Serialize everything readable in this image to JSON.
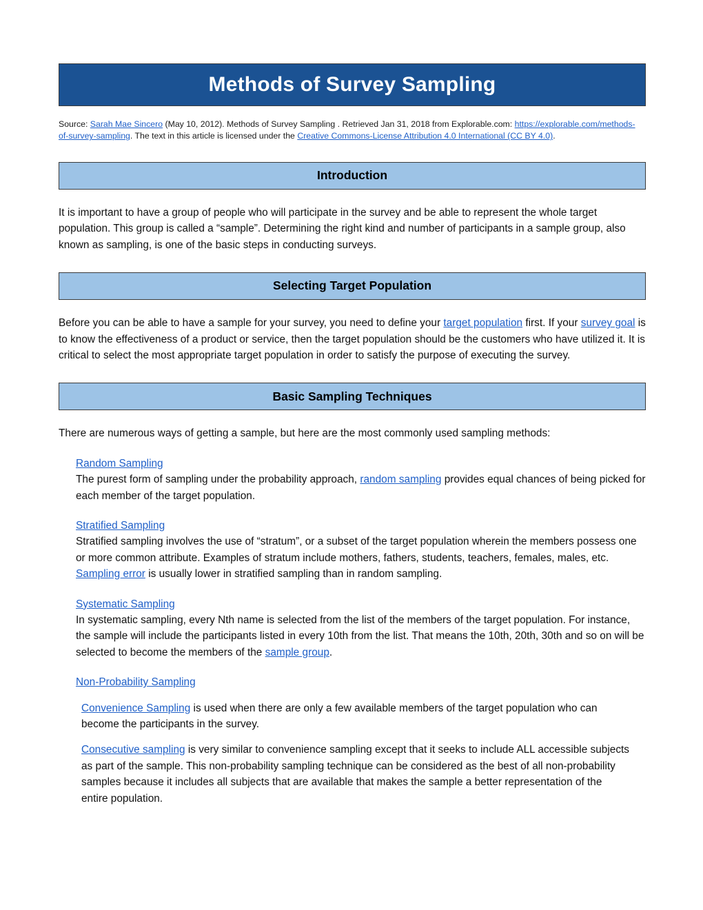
{
  "document": {
    "title": "Methods of Survey Sampling",
    "colors": {
      "banner_blue": "#1B5293",
      "section_blue": "#9DC3E6",
      "link_blue": "#2060C8",
      "border_gray": "#3A3A3A"
    }
  },
  "source": {
    "label": "Source: ",
    "author": "Sarah Mae Sincero",
    "after_author": " (May 10, 2012). Methods of Survey Sampling . Retrieved Jan 31, 2018 from Explorable.com: ",
    "url": "https://explorable.com/methods-of-survey-sampling",
    "license_intro": ". The text in this article is licensed under the ",
    "license_name": "Creative Commons-License Attribution 4.0 International (CC BY 4.0)",
    "license_end": "."
  },
  "sections": {
    "introduction": {
      "heading": "Introduction",
      "paragraph": "It is important to have a group of people who will participate in the survey and be able to represent the whole target population. This group is called a “sample”. Determining the right kind and number of participants in a sample group, also known as sampling, is one of the basic steps in conducting surveys."
    },
    "selecting_target_population": {
      "heading": "Selecting Target Population",
      "p_part1": "Before you can be able to have a sample for your survey, you need to define your ",
      "link1": "target population",
      "p_part2": " first. If your ",
      "link2": "survey goal",
      "p_part3": " is to know the effectiveness of a product or service, then the target population should be the customers who have utilized it. It is critical to select the most appropriate target population in order to satisfy the purpose of executing the survey."
    },
    "basic_sampling_techniques": {
      "heading": "Basic Sampling Techniques",
      "intro": "There are numerous ways of getting a sample, but here are the most commonly used sampling methods:",
      "methods": [
        {
          "title": "Random Sampling",
          "body_part1": "The purest form of sampling under the probability approach, ",
          "link": "random sampling",
          "body_part2": " provides equal chances of being picked for each member of the target population."
        },
        {
          "title": "Stratified Sampling",
          "body_part1": "Stratified sampling involves the use of “stratum”, or a subset of the target population wherein the members possess one or more common attribute. Examples of stratum include mothers, fathers, students, teachers, females, males, etc. ",
          "link": "Sampling error",
          "body_part2": " is usually lower in stratified sampling than in random sampling."
        },
        {
          "title": "Systematic Sampling",
          "body_part1": "In systematic sampling, every Nth name is selected from the list of the members of the target population. For instance, the sample will include the participants listed in every 10th from the list. That means the 10th, 20th, 30th and so on will be selected to become the members of the ",
          "link": "sample group",
          "body_part2": "."
        }
      ],
      "non_probability": {
        "title": "Non-Probability Sampling",
        "items": [
          {
            "link": "Convenience Sampling",
            "body": " is used when there are only a few available members of the target population who can become the participants in the survey."
          },
          {
            "link": "Consecutive sampling",
            "body": " is very similar to convenience sampling except that it seeks to include ALL accessible subjects as part of the sample. This non-probability sampling technique can be considered as the best of all non-probability samples because it includes all subjects that are available that makes the sample a better representation of the entire population."
          }
        ]
      }
    }
  }
}
